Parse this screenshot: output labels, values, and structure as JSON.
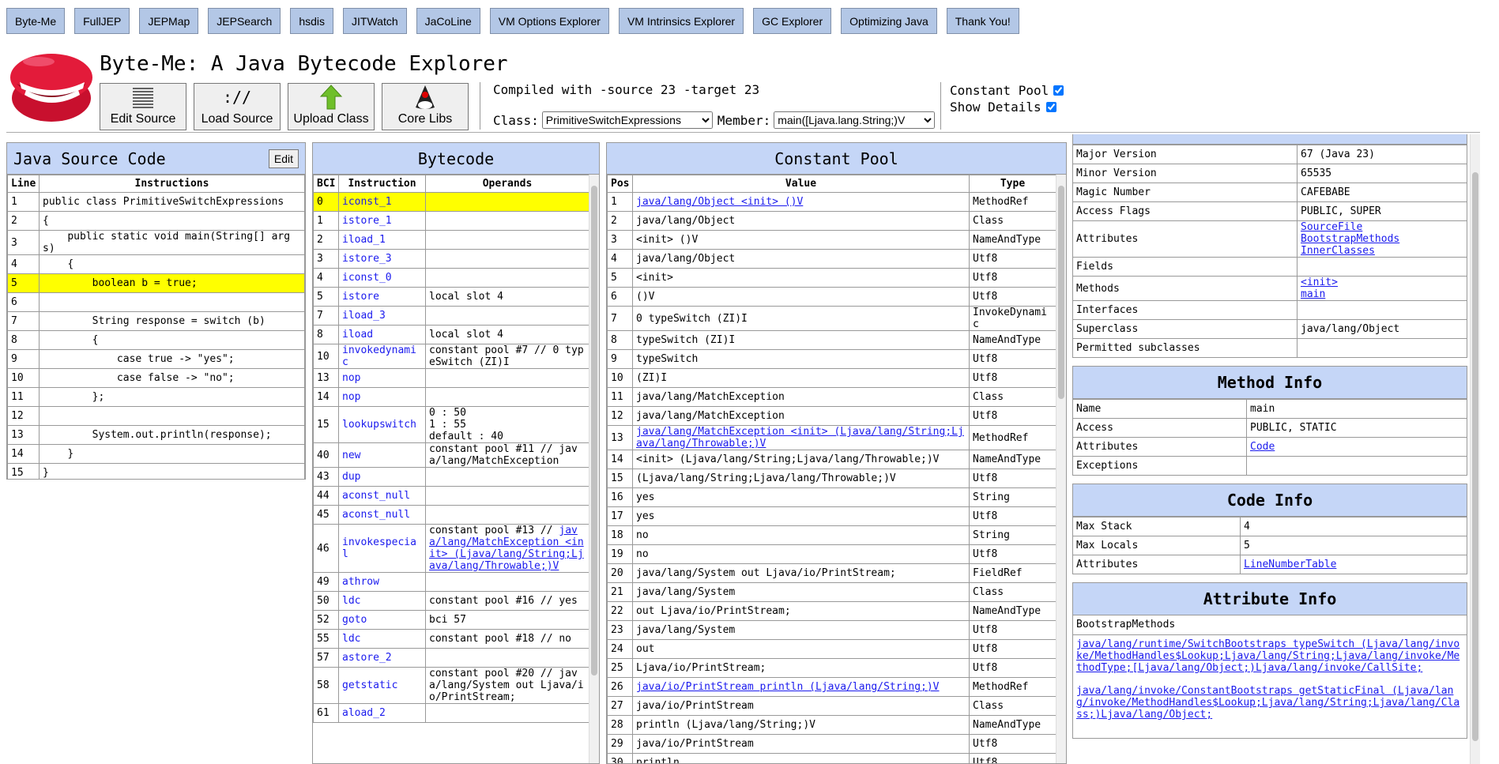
{
  "nav": [
    "Byte-Me",
    "FullJEP",
    "JEPMap",
    "JEPSearch",
    "hsdis",
    "JITWatch",
    "JaCoLine",
    "VM Options Explorer",
    "VM Intrinsics Explorer",
    "GC Explorer",
    "Optimizing Java",
    "Thank You!"
  ],
  "title": "Byte-Me: A Java Bytecode Explorer",
  "tools": {
    "edit": "Edit Source",
    "load": "Load Source",
    "upload": "Upload Class",
    "core": "Core Libs"
  },
  "compiled": "Compiled with -source 23 -target 23",
  "class_label": "Class:",
  "class_value": "PrimitiveSwitchExpressions",
  "member_label": "Member:",
  "member_value": "main([Ljava.lang.String;)V",
  "options": {
    "constant_pool": "Constant Pool",
    "show_details": "Show Details"
  },
  "source": {
    "title": "Java Source Code",
    "edit": "Edit",
    "headers": [
      "Line",
      "Instructions"
    ],
    "rows": [
      [
        "1",
        "public class PrimitiveSwitchExpressions"
      ],
      [
        "2",
        "{"
      ],
      [
        "3",
        "    public static void main(String[] args)"
      ],
      [
        "4",
        "    {"
      ],
      [
        "5",
        "        boolean b = true;"
      ],
      [
        "6",
        ""
      ],
      [
        "7",
        "        String response = switch (b)"
      ],
      [
        "8",
        "        {"
      ],
      [
        "9",
        "            case true -> \"yes\";"
      ],
      [
        "10",
        "            case false -> \"no\";"
      ],
      [
        "11",
        "        };"
      ],
      [
        "12",
        ""
      ],
      [
        "13",
        "        System.out.println(response);"
      ],
      [
        "14",
        "    }"
      ],
      [
        "15",
        "}"
      ]
    ],
    "highlight": 4
  },
  "bytecode": {
    "title": "Bytecode",
    "headers": [
      "BCI",
      "Instruction",
      "Operands"
    ],
    "rows": [
      [
        "0",
        "iconst_1",
        ""
      ],
      [
        "1",
        "istore_1",
        ""
      ],
      [
        "2",
        "iload_1",
        ""
      ],
      [
        "3",
        "istore_3",
        ""
      ],
      [
        "4",
        "iconst_0",
        ""
      ],
      [
        "5",
        "istore",
        "local slot 4"
      ],
      [
        "7",
        "iload_3",
        ""
      ],
      [
        "8",
        "iload",
        "local slot 4"
      ],
      [
        "10",
        "invokedynamic",
        "constant pool #7 // 0 typeSwitch (ZI)I"
      ],
      [
        "13",
        "nop",
        ""
      ],
      [
        "14",
        "nop",
        ""
      ],
      [
        "15",
        "lookupswitch",
        "0 : 50\n1 : 55\ndefault : 40"
      ],
      [
        "40",
        "new",
        "constant pool #11 // java/lang/MatchException"
      ],
      [
        "43",
        "dup",
        ""
      ],
      [
        "44",
        "aconst_null",
        ""
      ],
      [
        "45",
        "aconst_null",
        ""
      ],
      [
        "46",
        "invokespecial",
        "constant pool #13 // |java/lang/MatchException <init> (Ljava/lang/String;Ljava/lang/Throwable;)V"
      ],
      [
        "49",
        "athrow",
        ""
      ],
      [
        "50",
        "ldc",
        "constant pool #16 // yes"
      ],
      [
        "52",
        "goto",
        "bci 57"
      ],
      [
        "55",
        "ldc",
        "constant pool #18 // no"
      ],
      [
        "57",
        "astore_2",
        ""
      ],
      [
        "58",
        "getstatic",
        "constant pool #20 // java/lang/System out Ljava/io/PrintStream;"
      ],
      [
        "61",
        "aload_2",
        ""
      ]
    ],
    "highlight": 0
  },
  "cpool": {
    "title": "Constant Pool",
    "headers": [
      "Pos",
      "Value",
      "Type"
    ],
    "rows": [
      [
        "1",
        "java/lang/Object <init> ()V",
        "MethodRef",
        "link"
      ],
      [
        "2",
        "java/lang/Object",
        "Class",
        ""
      ],
      [
        "3",
        "<init> ()V",
        "NameAndType",
        ""
      ],
      [
        "4",
        "java/lang/Object",
        "Utf8",
        ""
      ],
      [
        "5",
        "<init>",
        "Utf8",
        ""
      ],
      [
        "6",
        "()V",
        "Utf8",
        ""
      ],
      [
        "7",
        "0 typeSwitch (ZI)I",
        "InvokeDynamic",
        ""
      ],
      [
        "8",
        "typeSwitch (ZI)I",
        "NameAndType",
        ""
      ],
      [
        "9",
        "typeSwitch",
        "Utf8",
        ""
      ],
      [
        "10",
        "(ZI)I",
        "Utf8",
        ""
      ],
      [
        "11",
        "java/lang/MatchException",
        "Class",
        ""
      ],
      [
        "12",
        "java/lang/MatchException",
        "Utf8",
        ""
      ],
      [
        "13",
        "java/lang/MatchException <init> (Ljava/lang/String;Ljava/lang/Throwable;)V",
        "MethodRef",
        "link"
      ],
      [
        "14",
        "<init> (Ljava/lang/String;Ljava/lang/Throwable;)V",
        "NameAndType",
        ""
      ],
      [
        "15",
        "(Ljava/lang/String;Ljava/lang/Throwable;)V",
        "Utf8",
        ""
      ],
      [
        "16",
        "yes",
        "String",
        ""
      ],
      [
        "17",
        "yes",
        "Utf8",
        ""
      ],
      [
        "18",
        "no",
        "String",
        ""
      ],
      [
        "19",
        "no",
        "Utf8",
        ""
      ],
      [
        "20",
        "java/lang/System out Ljava/io/PrintStream;",
        "FieldRef",
        ""
      ],
      [
        "21",
        "java/lang/System",
        "Class",
        ""
      ],
      [
        "22",
        "out Ljava/io/PrintStream;",
        "NameAndType",
        ""
      ],
      [
        "23",
        "java/lang/System",
        "Utf8",
        ""
      ],
      [
        "24",
        "out",
        "Utf8",
        ""
      ],
      [
        "25",
        "Ljava/io/PrintStream;",
        "Utf8",
        ""
      ],
      [
        "26",
        "java/io/PrintStream println (Ljava/lang/String;)V",
        "MethodRef",
        "link"
      ],
      [
        "27",
        "java/io/PrintStream",
        "Class",
        ""
      ],
      [
        "28",
        "println (Ljava/lang/String;)V",
        "NameAndType",
        ""
      ],
      [
        "29",
        "java/io/PrintStream",
        "Utf8",
        ""
      ],
      [
        "30",
        "println",
        "Utf8",
        ""
      ]
    ]
  },
  "class_info": {
    "rows": [
      [
        "Major Version",
        "67 (Java 23)"
      ],
      [
        "Minor Version",
        "65535"
      ],
      [
        "Magic Number",
        "CAFEBABE"
      ],
      [
        "Access Flags",
        "PUBLIC, SUPER"
      ],
      [
        "Attributes",
        "SourceFile\nBootstrapMethods\nInnerClasses",
        "link"
      ],
      [
        "Fields",
        ""
      ],
      [
        "Methods",
        "<init>\nmain",
        "link"
      ],
      [
        "Interfaces",
        ""
      ],
      [
        "Superclass",
        "java/lang/Object"
      ],
      [
        "Permitted subclasses",
        ""
      ]
    ]
  },
  "method_info": {
    "title": "Method Info",
    "rows": [
      [
        "Name",
        "main"
      ],
      [
        "Access",
        "PUBLIC, STATIC"
      ],
      [
        "Attributes",
        "Code",
        "link"
      ],
      [
        "Exceptions",
        ""
      ]
    ]
  },
  "code_info": {
    "title": "Code Info",
    "rows": [
      [
        "Max Stack",
        "4"
      ],
      [
        "Max Locals",
        "5"
      ],
      [
        "Attributes",
        "LineNumberTable",
        "link"
      ]
    ]
  },
  "attr_info": {
    "title": "Attribute Info",
    "name": "BootstrapMethods",
    "items": [
      "java/lang/runtime/SwitchBootstraps typeSwitch (Ljava/lang/invoke/MethodHandles$Lookup;Ljava/lang/String;Ljava/lang/invoke/MethodType;[Ljava/lang/Object;)Ljava/lang/invoke/CallSite;",
      "java/lang/invoke/ConstantBootstraps getStaticFinal (Ljava/lang/invoke/MethodHandles$Lookup;Ljava/lang/String;Ljava/lang/Class;)Ljava/lang/Object;"
    ]
  }
}
